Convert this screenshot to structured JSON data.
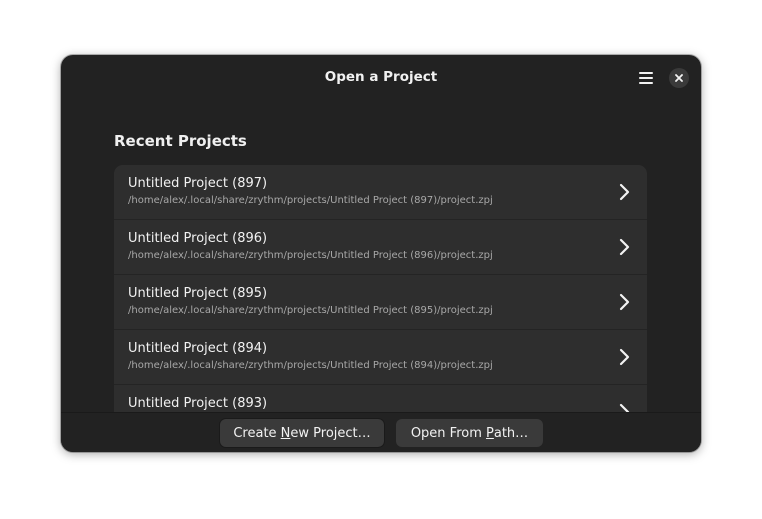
{
  "window": {
    "title": "Open a Project",
    "menu_icon": "hamburger-menu-icon",
    "close_icon": "close-icon"
  },
  "recent": {
    "heading": "Recent Projects",
    "items": [
      {
        "title": "Untitled Project (897)",
        "path": "/home/alex/.local/share/zrythm/projects/Untitled Project (897)/project.zpj"
      },
      {
        "title": "Untitled Project (896)",
        "path": "/home/alex/.local/share/zrythm/projects/Untitled Project (896)/project.zpj"
      },
      {
        "title": "Untitled Project (895)",
        "path": "/home/alex/.local/share/zrythm/projects/Untitled Project (895)/project.zpj"
      },
      {
        "title": "Untitled Project (894)",
        "path": "/home/alex/.local/share/zrythm/projects/Untitled Project (894)/project.zpj"
      },
      {
        "title": "Untitled Project (893)",
        "path": ""
      }
    ]
  },
  "footer": {
    "create_label": {
      "before": "Create ",
      "mnemonic": "N",
      "after": "ew Project…"
    },
    "open_label": {
      "before": "Open From ",
      "mnemonic": "P",
      "after": "ath…"
    }
  },
  "colors": {
    "window_bg": "#222222",
    "row_bg": "#2e2e2e",
    "button_bg": "#3a3a3a",
    "text": "#f2f2f2",
    "subtext": "#a8a8a8"
  }
}
